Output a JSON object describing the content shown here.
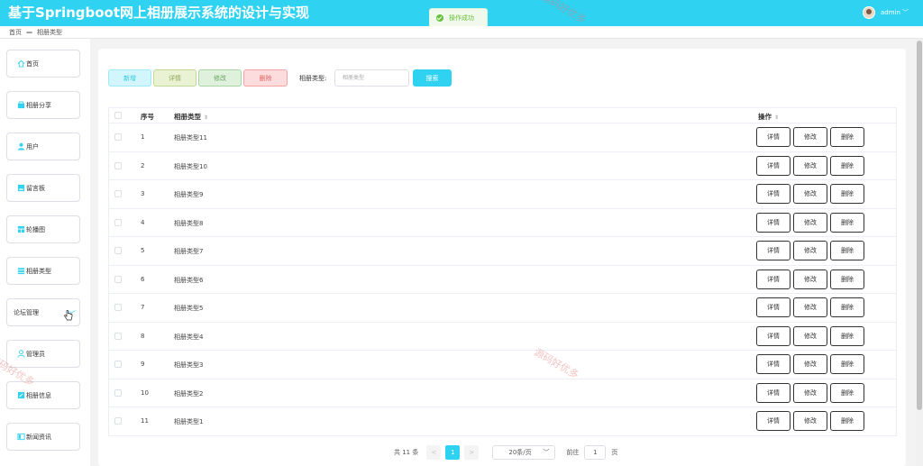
{
  "header": {
    "title": "基于Springboot网上相册展示系统的设计与实现",
    "username": "admin",
    "toast": "操作成功"
  },
  "breadcrumb": {
    "home": "首页",
    "current": "相册类型"
  },
  "sidebar": {
    "items": [
      {
        "label": "首页",
        "icon": "home-icon"
      },
      {
        "label": "相册分享",
        "icon": "share-icon"
      },
      {
        "label": "用户",
        "icon": "user-icon"
      },
      {
        "label": "留言板",
        "icon": "board-icon"
      },
      {
        "label": "轮播图",
        "icon": "carousel-icon"
      },
      {
        "label": "相册类型",
        "icon": "list-icon"
      },
      {
        "label": "论坛管理",
        "icon": ""
      },
      {
        "label": "管理员",
        "icon": "admin-icon"
      },
      {
        "label": "相册信息",
        "icon": "edit-icon"
      },
      {
        "label": "新闻资讯",
        "icon": "news-icon"
      }
    ]
  },
  "toolbar": {
    "add": "新增",
    "detail": "详情",
    "edit": "修改",
    "delete": "删除",
    "search_label": "相册类型:",
    "search_placeholder": "相册类型",
    "search": "搜索"
  },
  "table": {
    "headers": {
      "index": "序号",
      "type": "相册类型",
      "ops": "操作"
    },
    "row_buttons": {
      "detail": "详情",
      "edit": "修改",
      "delete": "删除"
    },
    "rows": [
      {
        "index": "1",
        "type": "相册类型11"
      },
      {
        "index": "2",
        "type": "相册类型10"
      },
      {
        "index": "3",
        "type": "相册类型9"
      },
      {
        "index": "4",
        "type": "相册类型8"
      },
      {
        "index": "5",
        "type": "相册类型7"
      },
      {
        "index": "6",
        "type": "相册类型6"
      },
      {
        "index": "7",
        "type": "相册类型5"
      },
      {
        "index": "8",
        "type": "相册类型4"
      },
      {
        "index": "9",
        "type": "相册类型3"
      },
      {
        "index": "10",
        "type": "相册类型2"
      },
      {
        "index": "11",
        "type": "相册类型1"
      }
    ]
  },
  "pagination": {
    "total": "共 11 条",
    "prev": "<",
    "current": "1",
    "next": ">",
    "page_size": "20条/页",
    "goto_label": "前往",
    "goto_value": "1",
    "page_unit": "页"
  },
  "watermark": "源码好优多",
  "colors": {
    "accent": "#2fd2f1",
    "success": "#67c23a"
  }
}
